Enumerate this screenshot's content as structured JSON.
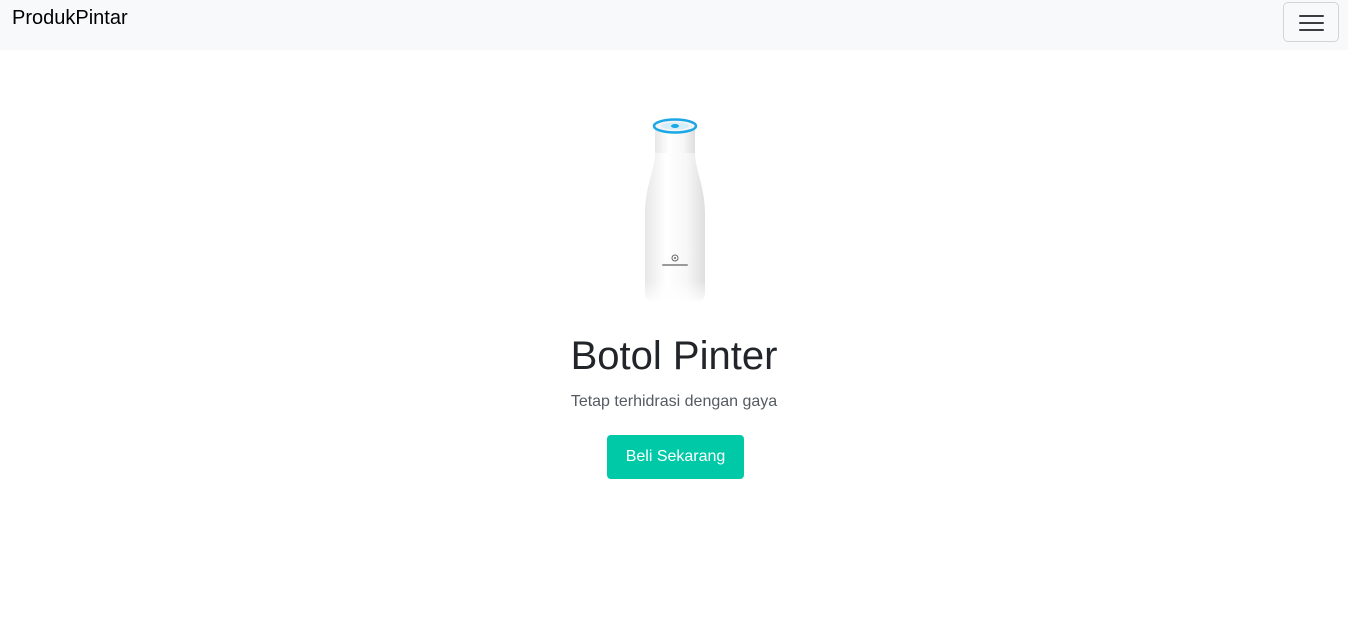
{
  "navbar": {
    "brand": "ProdukPintar",
    "toggle_icon": "hamburger-menu-icon"
  },
  "hero": {
    "image_name": "smart-bottle",
    "title": "Botol Pinter",
    "subtitle": "Tetap terhidrasi dengan gaya",
    "cta_label": "Beli Sekarang"
  },
  "colors": {
    "navbar_bg": "#f8f9fa",
    "cta_bg": "#00c9a7",
    "bottle_cap_ring": "#1aa7e6"
  }
}
